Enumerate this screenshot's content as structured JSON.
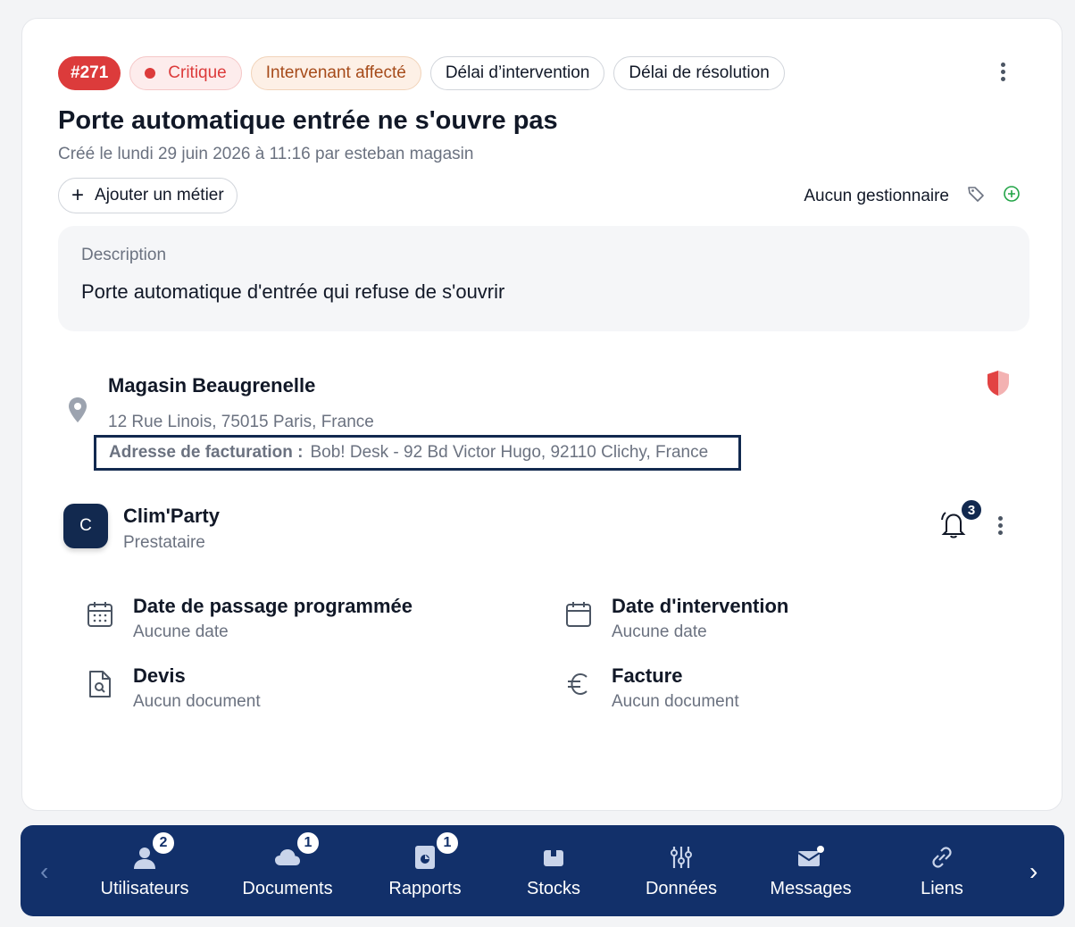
{
  "ticket": {
    "id": "#271",
    "priority": "Critique",
    "status": "Intervenant affecté",
    "intervention_delay": "Délai d’intervention",
    "resolution_delay": "Délai de résolution",
    "title": "Porte automatique entrée ne s'ouvre pas",
    "created": "Créé le lundi 29 juin 2026 à 11:16 par esteban magasin",
    "add_trade_label": "Ajouter un métier",
    "manager": "Aucun gestionnaire"
  },
  "description": {
    "label": "Description",
    "text": "Porte automatique d'entrée qui refuse de s'ouvrir"
  },
  "location": {
    "name": "Magasin Beaugrenelle",
    "address": "12 Rue Linois, 75015 Paris, France",
    "billing_label": "Adresse de facturation :",
    "billing_value": "Bob! Desk - 92 Bd Victor Hugo, 92110 Clichy, France"
  },
  "provider": {
    "initial": "C",
    "name": "Clim'Party",
    "role": "Prestataire",
    "notifications": "3"
  },
  "details": {
    "scheduled": {
      "title": "Date de passage programmée",
      "value": "Aucune date"
    },
    "intervention": {
      "title": "Date d'intervention",
      "value": "Aucune date"
    },
    "quote": {
      "title": "Devis",
      "value": "Aucun document"
    },
    "invoice": {
      "title": "Facture",
      "value": "Aucun document"
    }
  },
  "bottom_nav": {
    "items": [
      {
        "label": "Utilisateurs",
        "badge": "2",
        "icon": "users-icon"
      },
      {
        "label": "Documents",
        "badge": "1",
        "icon": "cloud-icon"
      },
      {
        "label": "Rapports",
        "badge": "1",
        "icon": "report-icon"
      },
      {
        "label": "Stocks",
        "icon": "box-icon"
      },
      {
        "label": "Données",
        "icon": "sliders-icon"
      },
      {
        "label": "Messages",
        "icon": "mail-icon"
      },
      {
        "label": "Liens",
        "icon": "link-icon"
      }
    ]
  },
  "colors": {
    "critical": "#dc3b3b",
    "navy": "#12306a",
    "status_text": "#a64b1a"
  }
}
